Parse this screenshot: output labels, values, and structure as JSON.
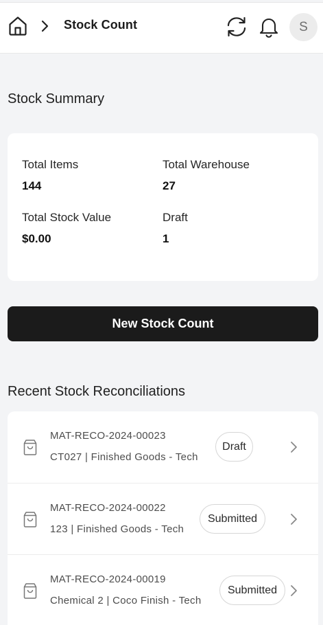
{
  "header": {
    "title": "Stock Count",
    "avatar_initial": "S",
    "icons": [
      "home-icon",
      "chevron-right-icon",
      "refresh-icon",
      "bell-icon"
    ]
  },
  "summary": {
    "title": "Stock Summary",
    "stats": [
      {
        "label": "Total Items",
        "value": "144"
      },
      {
        "label": "Total Warehouse",
        "value": "27"
      },
      {
        "label": "Total Stock Value",
        "value": "$0.00"
      },
      {
        "label": "Draft",
        "value": "1"
      }
    ]
  },
  "actions": {
    "new_stock_count": "New Stock Count"
  },
  "recent": {
    "title": "Recent Stock Reconciliations",
    "items": [
      {
        "id": "MAT-RECO-2024-00023",
        "desc": "CT027 | Finished Goods - Tech",
        "status": "Draft"
      },
      {
        "id": "MAT-RECO-2024-00022",
        "desc": "123 | Finished Goods - Tech",
        "status": "Submitted"
      },
      {
        "id": "MAT-RECO-2024-00019",
        "desc": "Chemical 2 | Coco Finish - Tech",
        "status": "Submitted"
      }
    ]
  },
  "colors": {
    "background": "#f3f4f6",
    "card": "#ffffff",
    "primary_button": "#1b1b1b",
    "text": "#1a1a1a"
  }
}
